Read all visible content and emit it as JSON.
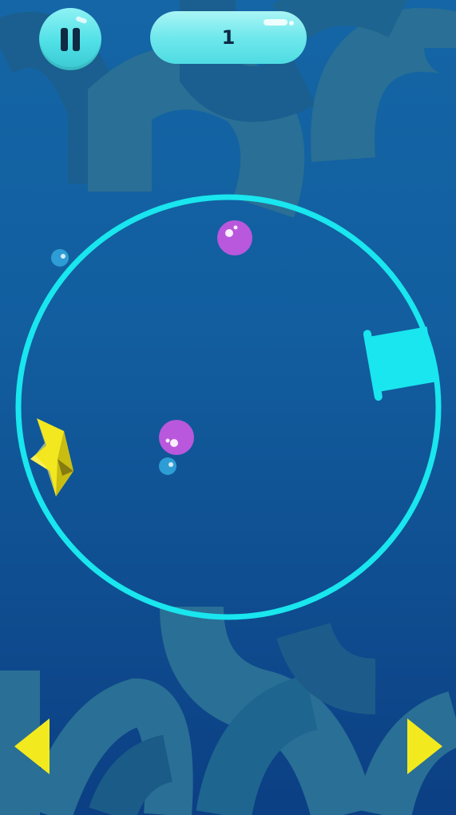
{
  "hud": {
    "score": "1"
  },
  "controls": {
    "pause": "pause-icon",
    "left": "arrow-left-icon",
    "right": "arrow-right-icon"
  },
  "colors": {
    "ring": "#19e6ee",
    "bubble_purple": "#b957dd",
    "bubble_blue": "#2e9dd6",
    "player": "#f3e81f",
    "arrow": "#f2ea1e"
  }
}
